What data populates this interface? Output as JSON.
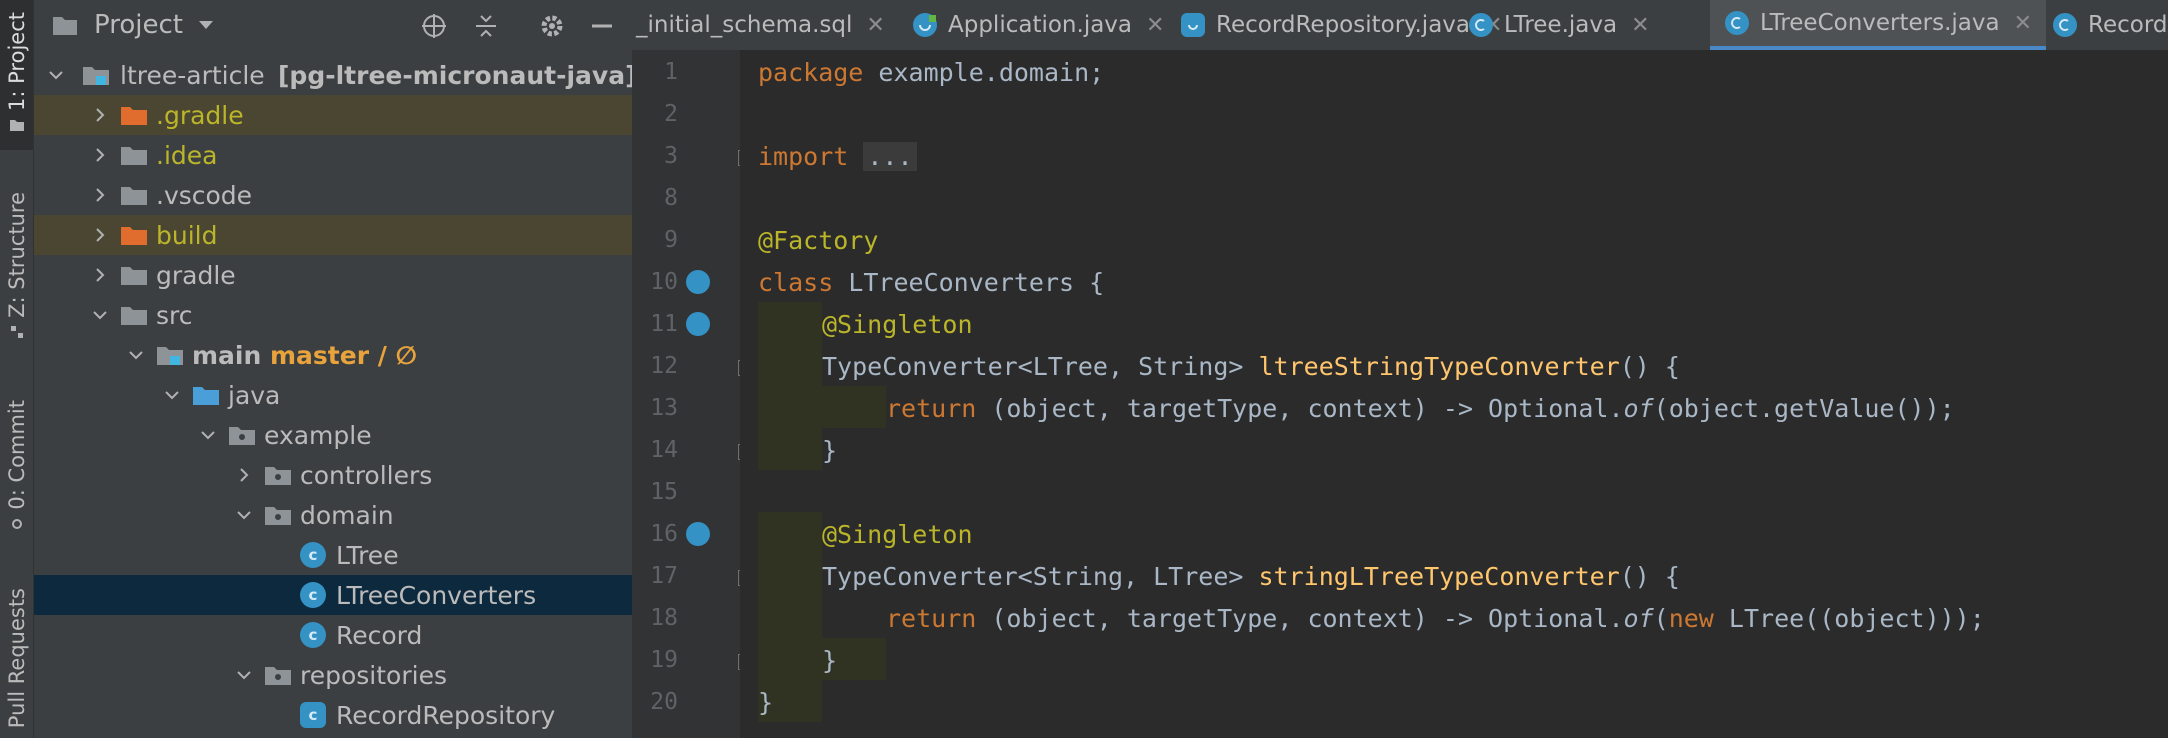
{
  "sidebar_tabs": [
    {
      "label": "1: Project",
      "active": true
    },
    {
      "label": "Z: Structure",
      "active": false
    },
    {
      "label": "0: Commit",
      "active": false
    },
    {
      "label": "Pull Requests",
      "active": false
    }
  ],
  "project_panel": {
    "title": "Project",
    "tree": [
      {
        "label": "ltree-article",
        "extra": "[pg-ltree-micronaut-java]",
        "kind": "module"
      },
      {
        "label": ".gradle",
        "kind": "folder-excluded"
      },
      {
        "label": ".idea",
        "kind": "folder"
      },
      {
        "label": ".vscode",
        "kind": "folder"
      },
      {
        "label": "build",
        "kind": "folder-excluded"
      },
      {
        "label": "gradle",
        "kind": "folder"
      },
      {
        "label": "src",
        "kind": "folder"
      },
      {
        "label": "main",
        "extra": "master / ∅",
        "kind": "module"
      },
      {
        "label": "java",
        "kind": "source-folder"
      },
      {
        "label": "example",
        "kind": "package"
      },
      {
        "label": "controllers",
        "kind": "package"
      },
      {
        "label": "domain",
        "kind": "package"
      },
      {
        "label": "LTree",
        "kind": "class"
      },
      {
        "label": "LTreeConverters",
        "kind": "class"
      },
      {
        "label": "Record",
        "kind": "class"
      },
      {
        "label": "repositories",
        "kind": "package"
      },
      {
        "label": "RecordRepository",
        "kind": "class"
      }
    ]
  },
  "editor_tabs": [
    {
      "label": "_initial_schema.sql",
      "active": false
    },
    {
      "label": "Application.java",
      "active": false
    },
    {
      "label": "RecordRepository.java",
      "active": false
    },
    {
      "label": "LTree.java",
      "active": false
    },
    {
      "label": "LTreeConverters.java",
      "active": true
    },
    {
      "label": "Record",
      "active": false
    }
  ],
  "line_numbers": [
    "1",
    "2",
    "3",
    "8",
    "9",
    "10",
    "11",
    "12",
    "13",
    "14",
    "15",
    "16",
    "17",
    "18",
    "19",
    "20"
  ],
  "code": {
    "l1_kw": "package",
    "l1_rest": " example.domain;",
    "l3_kw": "import",
    "l3_dots": "...",
    "l9_ann": "@Factory",
    "l10_kw": "class",
    "l10_rest": " LTreeConverters {",
    "l11_ann": "@Singleton",
    "l12_a": "TypeConverter<LTree, String> ",
    "l12_fn": "ltreeStringTypeConverter",
    "l12_b": "() {",
    "l13_kw": "return",
    "l13_a": " (object, targetType, context) -> Optional.",
    "l13_of": "of",
    "l13_b": "(object.getValue());",
    "l14": "}",
    "l16_ann": "@Singleton",
    "l17_a": "TypeConverter<String, LTree> ",
    "l17_fn": "stringLTreeTypeConverter",
    "l17_b": "() {",
    "l18_kw": "return",
    "l18_a": " (object, targetType, context) -> Optional.",
    "l18_of": "of",
    "l18_p": "(",
    "l18_new": "new",
    "l18_b": " LTree((object)));",
    "l19": "}",
    "l20": "}"
  },
  "colors": {
    "accent": "#4a88c7",
    "class_icon": "#3592c4",
    "keyword": "#cc7832",
    "annotation": "#bbb529",
    "function": "#ffc66d",
    "text": "#a9b7c6"
  }
}
